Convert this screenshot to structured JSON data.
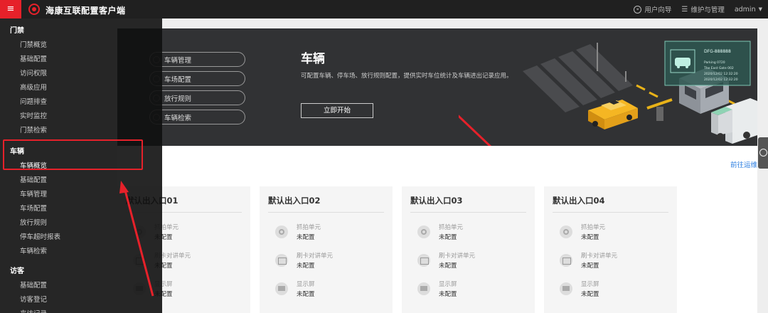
{
  "app": {
    "title": "海康互联配置客户端",
    "menu_icon": "menu-icon"
  },
  "topbar": {
    "guide_label": "用户向导",
    "manage_label": "维护与管理",
    "user_label": "admin"
  },
  "sidebar": {
    "groups": [
      {
        "label": "门禁",
        "items": [
          "门禁概览",
          "基础配置",
          "访问权限",
          "高级应用",
          "问题排查",
          "实时监控",
          "门禁检索"
        ]
      },
      {
        "label": "车辆",
        "items": [
          "车辆概览",
          "基础配置",
          "车辆管理",
          "车场配置",
          "放行规则",
          "停车超时报表",
          "车辆检索"
        ]
      },
      {
        "label": "访客",
        "items": [
          "基础配置",
          "访客登记",
          "来访记录"
        ]
      }
    ]
  },
  "banner": {
    "pills": [
      "车辆管理",
      "车场配置",
      "放行规则",
      "车辆检索"
    ],
    "title": "车辆",
    "desc": "可配置车辆、停车场、放行规则配置，提供实时车位统计及车辆进出记录应用。",
    "start_label": "立即开始",
    "plate_card": {
      "plate": "DFG-888888",
      "parking": "Parking 0720",
      "gate": "The East Gate 002",
      "time1": "2020/12/02 12:32:20",
      "time2": "2020/12/02 12:32:20"
    }
  },
  "link_ops": "前往运维",
  "cards": [
    {
      "title": "默认出入口01",
      "rows": [
        {
          "name": "抓拍单元",
          "status": "未配置",
          "icon": "camera-icon"
        },
        {
          "name": "刷卡对讲单元",
          "status": "未配置",
          "icon": "card-reader-icon"
        },
        {
          "name": "显示屏",
          "status": "未配置",
          "icon": "screen-icon"
        }
      ]
    },
    {
      "title": "默认出入口02",
      "rows": [
        {
          "name": "抓拍单元",
          "status": "未配置",
          "icon": "camera-icon"
        },
        {
          "name": "刷卡对讲单元",
          "status": "未配置",
          "icon": "card-reader-icon"
        },
        {
          "name": "显示屏",
          "status": "未配置",
          "icon": "screen-icon"
        }
      ]
    },
    {
      "title": "默认出入口03",
      "rows": [
        {
          "name": "抓拍单元",
          "status": "未配置",
          "icon": "camera-icon"
        },
        {
          "name": "刷卡对讲单元",
          "status": "未配置",
          "icon": "card-reader-icon"
        },
        {
          "name": "显示屏",
          "status": "未配置",
          "icon": "screen-icon"
        }
      ]
    },
    {
      "title": "默认出入口04",
      "rows": [
        {
          "name": "抓拍单元",
          "status": "未配置",
          "icon": "camera-icon"
        },
        {
          "name": "刷卡对讲单元",
          "status": "未配置",
          "icon": "card-reader-icon"
        },
        {
          "name": "显示屏",
          "status": "未配置",
          "icon": "screen-icon"
        }
      ]
    }
  ],
  "colors": {
    "accent": "#e6212a",
    "link": "#2a7de1",
    "topbar": "#202020",
    "banner": "#313234"
  }
}
